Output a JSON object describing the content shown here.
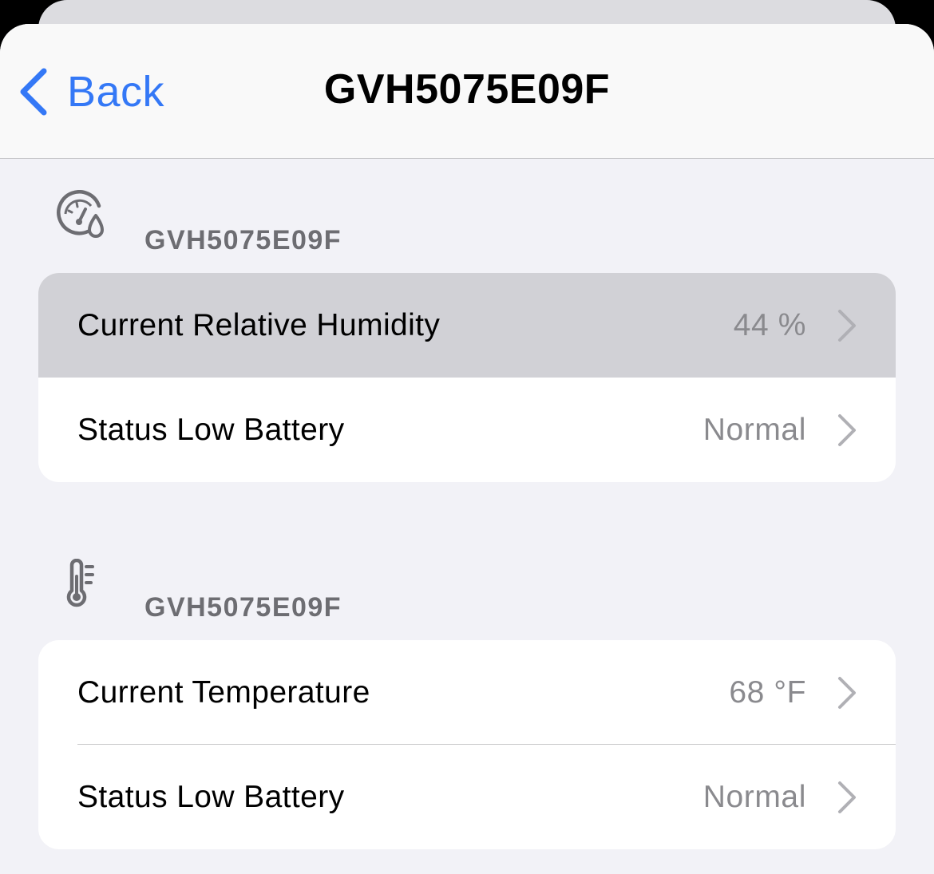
{
  "navbar": {
    "back_label": "Back",
    "title": "GVH5075E09F"
  },
  "sections": [
    {
      "icon": "humidity-gauge-icon",
      "title": "GVH5075E09F",
      "rows": [
        {
          "label": "Current Relative Humidity",
          "value": "44 %"
        },
        {
          "label": "Status Low Battery",
          "value": "Normal"
        }
      ]
    },
    {
      "icon": "thermometer-icon",
      "title": "GVH5075E09F",
      "rows": [
        {
          "label": "Current Temperature",
          "value": "68 °F"
        },
        {
          "label": "Status Low Battery",
          "value": "Normal"
        }
      ]
    }
  ],
  "colors": {
    "accent": "#3478f6",
    "background": "#f2f2f7",
    "secondary_text": "#8a8a8e",
    "highlight": "#d1d1d6"
  }
}
